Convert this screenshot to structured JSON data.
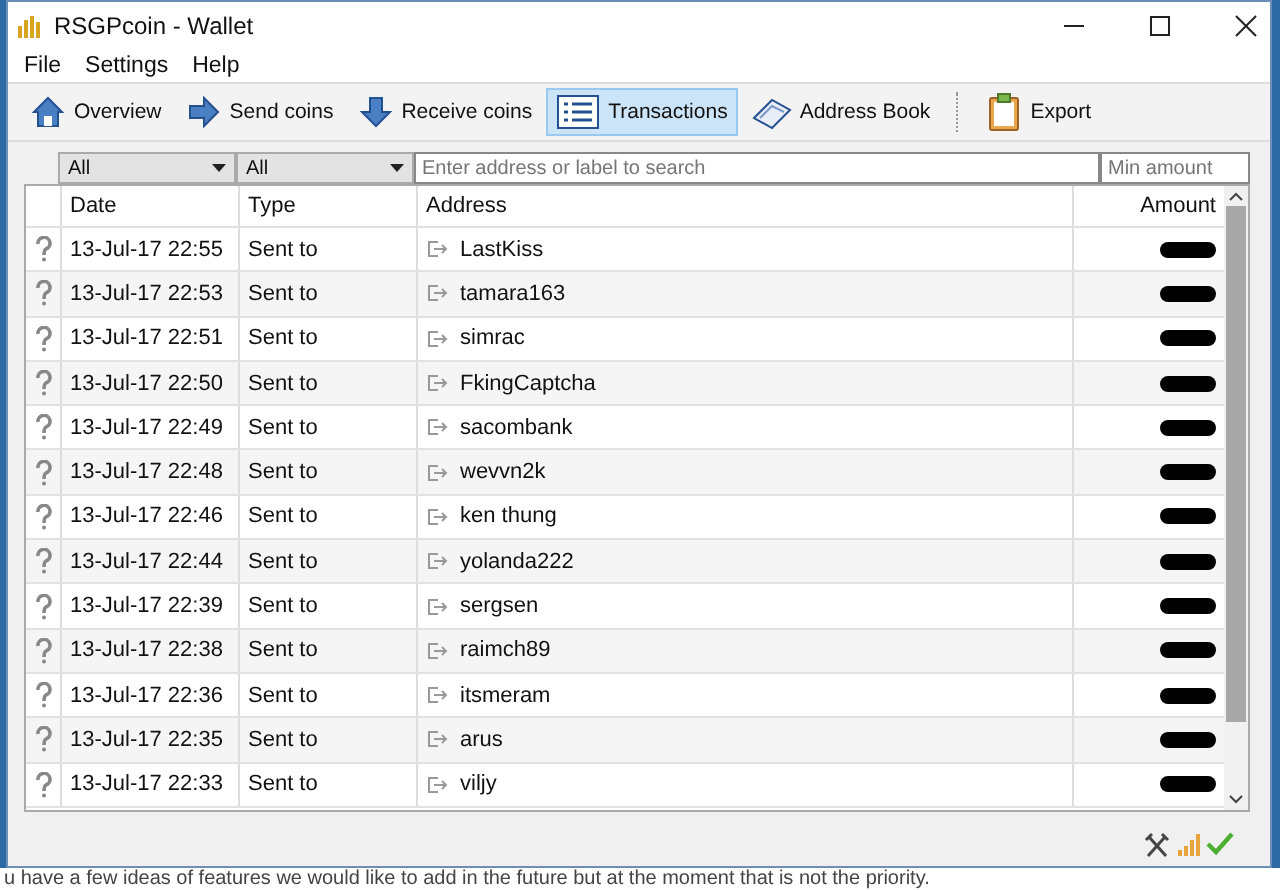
{
  "window": {
    "title": "RSGPcoin - Wallet"
  },
  "menu": [
    "File",
    "Settings",
    "Help"
  ],
  "toolbar": [
    {
      "kind": "overview",
      "label": "Overview",
      "selected": false
    },
    {
      "kind": "send",
      "label": "Send coins",
      "selected": false
    },
    {
      "kind": "receive",
      "label": "Receive coins",
      "selected": false
    },
    {
      "kind": "transactions",
      "label": "Transactions",
      "selected": true
    },
    {
      "kind": "addressbook",
      "label": "Address Book",
      "selected": false
    },
    {
      "kind": "export",
      "label": "Export",
      "selected": false
    }
  ],
  "filters": {
    "date": "All",
    "type": "All",
    "search": {
      "placeholder": "Enter address or label to search"
    },
    "min_amount": {
      "placeholder": "Min amount"
    }
  },
  "table": {
    "columns": [
      "Date",
      "Type",
      "Address",
      "Amount"
    ],
    "rows": [
      {
        "date": "13-Jul-17 22:55",
        "type": "Sent to",
        "address": "LastKiss"
      },
      {
        "date": "13-Jul-17 22:53",
        "type": "Sent to",
        "address": "tamara163"
      },
      {
        "date": "13-Jul-17 22:51",
        "type": "Sent to",
        "address": "simrac"
      },
      {
        "date": "13-Jul-17 22:50",
        "type": "Sent to",
        "address": "FkingCaptcha"
      },
      {
        "date": "13-Jul-17 22:49",
        "type": "Sent to",
        "address": "sacombank"
      },
      {
        "date": "13-Jul-17 22:48",
        "type": "Sent to",
        "address": "wevvn2k"
      },
      {
        "date": "13-Jul-17 22:46",
        "type": "Sent to",
        "address": "ken thung"
      },
      {
        "date": "13-Jul-17 22:44",
        "type": "Sent to",
        "address": "yolanda222"
      },
      {
        "date": "13-Jul-17 22:39",
        "type": "Sent to",
        "address": "sergsen"
      },
      {
        "date": "13-Jul-17 22:38",
        "type": "Sent to",
        "address": "raimch89"
      },
      {
        "date": "13-Jul-17 22:36",
        "type": "Sent to",
        "address": "itsmeram"
      },
      {
        "date": "13-Jul-17 22:35",
        "type": "Sent to",
        "address": "arus"
      },
      {
        "date": "13-Jul-17 22:33",
        "type": "Sent to",
        "address": "viljy"
      }
    ]
  },
  "background_text": "u have a few ideas of features we would like to add in the future but at the moment that is not the priority."
}
